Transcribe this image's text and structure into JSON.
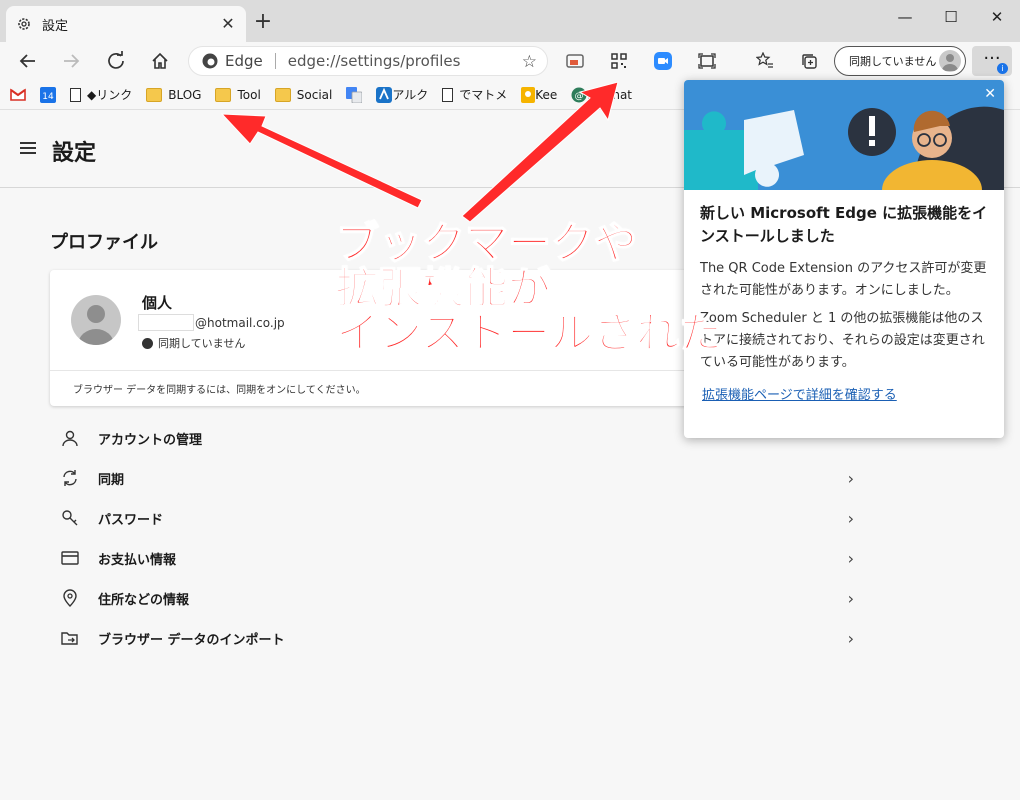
{
  "tab": {
    "title": "設定",
    "close": "✕",
    "new": "+"
  },
  "window": {
    "minimize": "—",
    "maximize": "☐",
    "close": "✕"
  },
  "address": {
    "brand": "Edge",
    "url": "edge://settings/profiles",
    "star": "☆"
  },
  "profile_button": {
    "label": "同期していません"
  },
  "menu": {
    "label": "···",
    "badge": "i"
  },
  "bookmarks": [
    {
      "label": "",
      "icon": "gmail-icon"
    },
    {
      "label": "",
      "icon": "calendar-icon",
      "text": "14"
    },
    {
      "label": "◆リンク",
      "icon": "page-icon"
    },
    {
      "label": "BLOG",
      "icon": "folder-icon"
    },
    {
      "label": "Tool",
      "icon": "folder-icon"
    },
    {
      "label": "Social",
      "icon": "folder-icon"
    },
    {
      "label": "",
      "icon": "translate-icon"
    },
    {
      "label": "アルク",
      "icon": "alc-icon"
    },
    {
      "label": "でマトメ",
      "icon": "page-icon"
    },
    {
      "label": "Kee",
      "icon": "keep-icon"
    },
    {
      "label": "HgChat",
      "icon": "chat-icon"
    }
  ],
  "settings": {
    "title": "設定",
    "section": "プロファイル",
    "profile": {
      "name": "個人",
      "email": "@hotmail.co.jp",
      "sync_status": "同期していません",
      "hint": "ブラウザー データを同期するには、同期をオンにしてください。"
    },
    "rows": [
      {
        "label": "アカウントの管理",
        "icon": "person-icon"
      },
      {
        "label": "同期",
        "icon": "sync-icon"
      },
      {
        "label": "パスワード",
        "icon": "key-icon"
      },
      {
        "label": "お支払い情報",
        "icon": "card-icon"
      },
      {
        "label": "住所などの情報",
        "icon": "location-icon"
      },
      {
        "label": "ブラウザー データのインポート",
        "icon": "import-icon"
      }
    ],
    "chevron": "›"
  },
  "popup": {
    "close": "✕",
    "title": "新しい Microsoft Edge に拡張機能をインストールしました",
    "body1": "The QR Code Extension のアクセス許可が変更された可能性があります。オンにしました。",
    "body2": "Zoom Scheduler と 1 の他の拡張機能は他のストアに接続されており、それらの設定は変更されている可能性があります。",
    "link": "拡張機能ページで詳細を確認する"
  },
  "annotation": {
    "line1": "ブックマークや",
    "line2": "拡張機能が",
    "line3": "インストールされた",
    "color": "#ff2a2a"
  }
}
